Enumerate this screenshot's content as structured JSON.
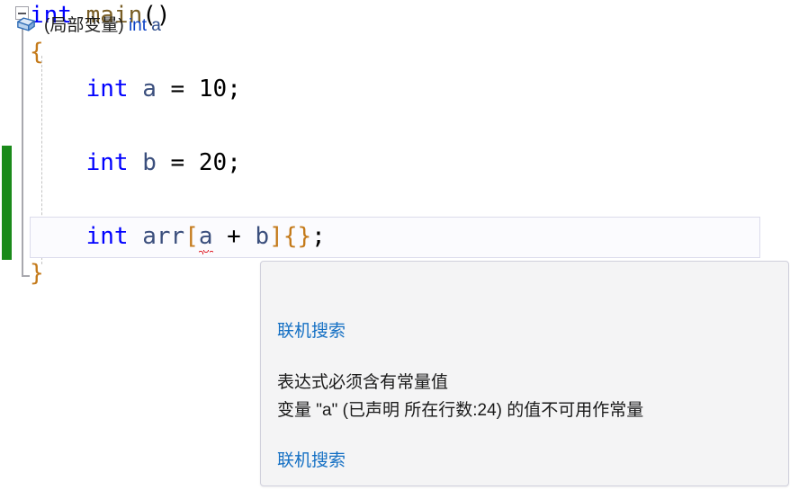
{
  "editor": {
    "name": "code-editor",
    "language": "cpp",
    "code_lines": [
      {
        "indent": 0,
        "tokens": [
          {
            "text": "int",
            "kind": "keyword"
          },
          {
            "text": " ",
            "kind": "plain"
          },
          {
            "text": "main",
            "kind": "function"
          },
          {
            "text": "()",
            "kind": "punctuation"
          }
        ]
      },
      {
        "indent": 1,
        "tokens": [
          {
            "text": "{",
            "kind": "bracket"
          }
        ]
      },
      {
        "indent": 2,
        "tokens": [
          {
            "text": "int",
            "kind": "keyword"
          },
          {
            "text": " ",
            "kind": "plain"
          },
          {
            "text": "a",
            "kind": "identifier"
          },
          {
            "text": " = ",
            "kind": "punctuation"
          },
          {
            "text": "10",
            "kind": "number"
          },
          {
            "text": ";",
            "kind": "punctuation"
          }
        ]
      },
      {
        "indent": 2,
        "tokens": [
          {
            "text": "int",
            "kind": "keyword"
          },
          {
            "text": " ",
            "kind": "plain"
          },
          {
            "text": "b",
            "kind": "identifier"
          },
          {
            "text": " = ",
            "kind": "punctuation"
          },
          {
            "text": "20",
            "kind": "number"
          },
          {
            "text": ";",
            "kind": "punctuation"
          }
        ]
      },
      {
        "indent": 2,
        "tokens": [
          {
            "text": "int",
            "kind": "keyword"
          },
          {
            "text": " ",
            "kind": "plain"
          },
          {
            "text": "arr",
            "kind": "identifier"
          },
          {
            "text": "[",
            "kind": "bracket"
          },
          {
            "text": "a",
            "kind": "identifier-error"
          },
          {
            "text": " + ",
            "kind": "punctuation"
          },
          {
            "text": "b",
            "kind": "identifier"
          },
          {
            "text": "]",
            "kind": "bracket"
          },
          {
            "text": "{}",
            "kind": "bracket"
          },
          {
            "text": ";",
            "kind": "punctuation"
          }
        ]
      },
      {
        "indent": 1,
        "tokens": [
          {
            "text": "}",
            "kind": "bracket"
          }
        ]
      }
    ],
    "text_line_1": "int main()",
    "text_line_2": "{",
    "text_line_3": "    int a = 10;",
    "text_line_4": "    int b = 20;",
    "text_line_5": "    int arr[a + b]{};",
    "text_line_6": "}",
    "gutter": {
      "collapse_icon": "collapse-minus-icon",
      "change_bar_color": "#1a8a1a",
      "outline_line_color": "#a8a8ae"
    },
    "current_line_index": 5,
    "error_token": "a",
    "error_underline_color": "#e01b24",
    "colors": {
      "keyword": "#0000ff",
      "function": "#795e26",
      "identifier": "#3b4f7d",
      "bracket": "#c47a1a",
      "plain": "#000000",
      "background": "#ffffff",
      "current_line_bg": "#fbfbfe",
      "current_line_border": "#dcdcec"
    }
  },
  "tooltip": {
    "name": "quick-info-tooltip",
    "icon": "local-variable-box-icon",
    "signature_prefix": "(局部变量) ",
    "signature_type": "int",
    "signature_space": " ",
    "signature_name": "a",
    "link_top": "联机搜索",
    "message_line_1": "表达式必须含有常量值",
    "message_line_2": "变量 \"a\" (已声明 所在行数:24) 的值不可用作常量",
    "link_bottom": "联机搜索",
    "colors": {
      "background": "#f4f4f5",
      "border": "#d0d0dc",
      "link": "#1570c4",
      "text": "#1a1a1a",
      "keyword": "#0b41c4"
    }
  }
}
